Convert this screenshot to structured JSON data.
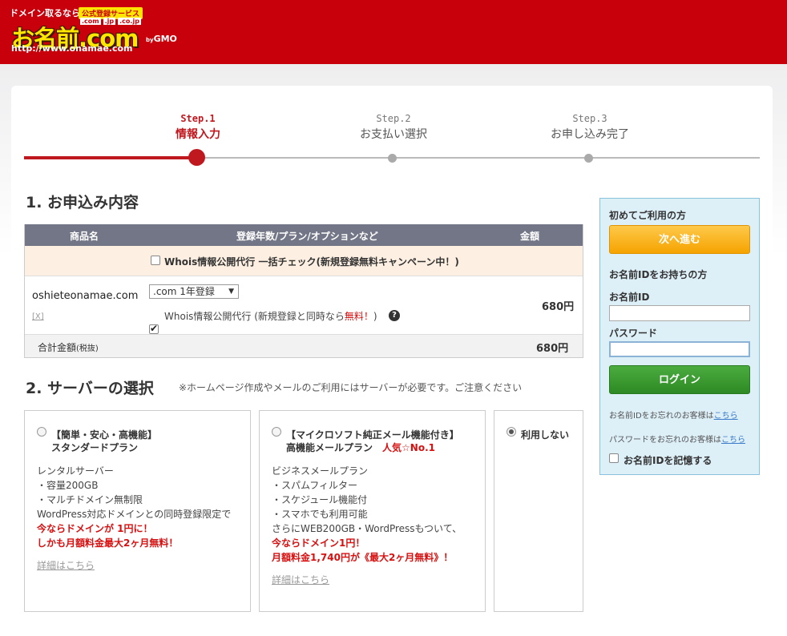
{
  "header": {
    "catch_copy": "ドメイン取るなら",
    "badge": "公式登録サービス",
    "tlds": [
      ".com",
      ".jp",
      ".co.jp"
    ],
    "brand": "お名前.com",
    "by": "by",
    "gmo": "GMO",
    "url": "http://www.onamae.com",
    "bg_color": "#c8000b"
  },
  "steps": [
    {
      "num": "Step.1",
      "name": "情報入力",
      "active": true
    },
    {
      "num": "Step.2",
      "name": "お支払い選択",
      "active": false
    },
    {
      "num": "Step.3",
      "name": "お申し込み完了",
      "active": false
    }
  ],
  "section1": {
    "title": "1. お申込み内容",
    "columns": [
      "商品名",
      "登録年数/プラン/オプションなど",
      "金額"
    ],
    "bulk_check_label": "Whois情報公開代行 一括チェック(新規登録無料キャンペーン中！)",
    "item": {
      "domain": "oshieteonamae.com",
      "remove": "[X]",
      "plan_select": ".com 1年登録",
      "whois_label": "Whois情報公開代行 (新規登録と同時なら",
      "whois_free": "無料！",
      "whois_close": ")",
      "help": "?",
      "price": "680円"
    },
    "total_label": "合計金額",
    "total_tax": "(税抜)",
    "total_value": "680円"
  },
  "section2": {
    "title": "2. サーバーの選択",
    "note": "※ホームページ作成やメールのご利用にはサーバーが必要です。ご注意ください",
    "plans": [
      {
        "title1": "【簡単・安心・高機能】",
        "title2": "スタンダードプラン",
        "lines": [
          "レンタルサーバー",
          "・容量200GB",
          "・マルチドメイン無制限",
          "WordPress対応ドメインとの同時登録限定で"
        ],
        "red_lines": [
          "今ならドメインが 1円に！",
          "しかも月額料金最大2ヶ月無料！"
        ],
        "link": "詳細はこちら"
      },
      {
        "title1": "【マイクロソフト純正メール機能付き】",
        "title2": "高機能メールプラン",
        "badge": "人気☆No.1",
        "lines": [
          "ビジネスメールプラン",
          "・スパムフィルター",
          "・スケジュール機能付",
          "・スマホでも利用可能",
          "さらにWEB200GB・WordPressもついて、"
        ],
        "red_lines": [
          "今ならドメイン1円！",
          "月額料金1,740円が《最大2ヶ月無料》！"
        ],
        "link": "詳細はこちら"
      },
      {
        "title1": "利用しない",
        "selected": true
      }
    ]
  },
  "sidebar": {
    "first_time": "初めてご利用の方",
    "next_button": "次へ進む",
    "have_id": "お名前IDをお持ちの方",
    "id_label": "お名前ID",
    "password_label": "パスワード",
    "login_button": "ログイン",
    "forgot_id": "お名前IDをお忘れのお客様は",
    "forgot_id_link": "こちら",
    "forgot_pw": "パスワードをお忘れのお客様は",
    "forgot_pw_link": "こちら",
    "remember": "お名前IDを記憶する"
  }
}
